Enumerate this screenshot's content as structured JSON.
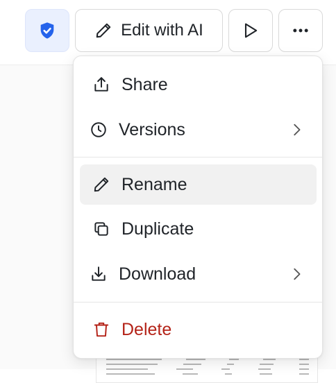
{
  "toolbar": {
    "shield_icon": "shield-check-icon",
    "edit_button": {
      "label": "Edit with AI",
      "icon": "pencil-icon"
    },
    "run_icon": "play-icon",
    "more_icon": "more-horizontal-icon"
  },
  "menu": {
    "items": [
      {
        "label": "Share",
        "icon": "share-icon",
        "submenu": false
      },
      {
        "label": "Versions",
        "icon": "clock-icon",
        "submenu": true
      },
      {
        "label": "Rename",
        "icon": "pencil-icon",
        "submenu": false,
        "highlighted": true
      },
      {
        "label": "Duplicate",
        "icon": "copy-icon",
        "submenu": false
      },
      {
        "label": "Download",
        "icon": "download-icon",
        "submenu": true
      },
      {
        "label": "Delete",
        "icon": "trash-icon",
        "submenu": false,
        "danger": true
      }
    ]
  },
  "colors": {
    "accent": "#2563eb",
    "danger": "#b42318",
    "highlight": "#f1f1f1"
  }
}
